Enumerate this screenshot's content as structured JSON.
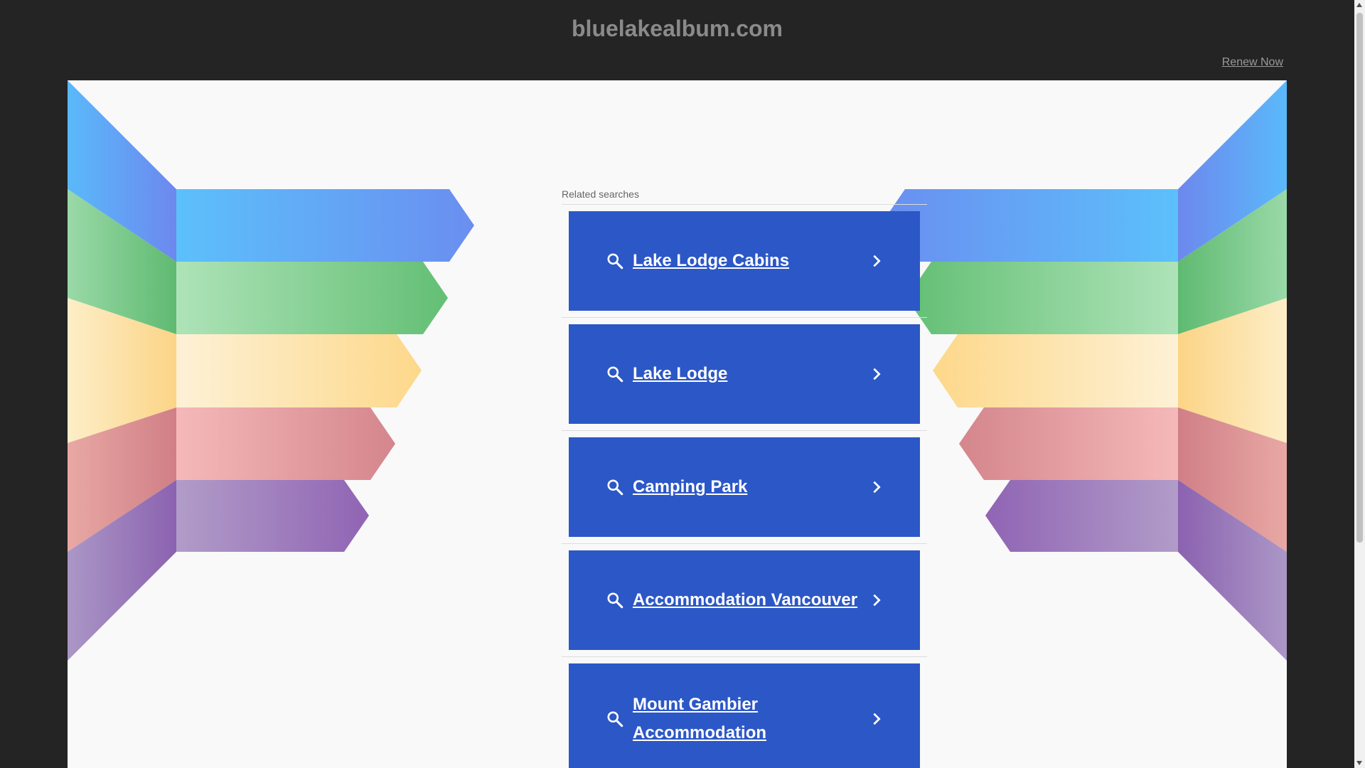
{
  "header": {
    "title": "bluelakealbum.com",
    "renew_label": "Renew Now"
  },
  "related": {
    "heading": "Related searches",
    "items": [
      {
        "label": "Lake Lodge Cabins"
      },
      {
        "label": "Lake Lodge"
      },
      {
        "label": "Camping Park"
      },
      {
        "label": "Accommodation Vancouver"
      },
      {
        "label": "Mount Gambier Accommodation"
      }
    ]
  },
  "icons": {
    "search": "search-icon",
    "chevron": "chevron-right-icon"
  },
  "colors": {
    "background": "#242424",
    "panel": "#f9f9f9",
    "card": "#2c57c6",
    "stripe_blue": "#5fa7f5",
    "stripe_green": "#7fce8c",
    "stripe_yellow": "#fde3a4",
    "stripe_pink": "#e59c9c",
    "stripe_purple": "#a98ac0"
  }
}
